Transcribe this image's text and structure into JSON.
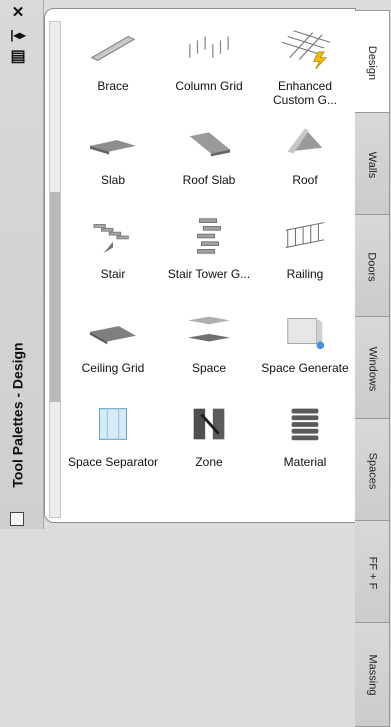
{
  "sidebar": {
    "title": "Tool Palettes - Design",
    "close_glyph": "✕",
    "autohide_glyph": "|◂▸",
    "properties_glyph": "▤",
    "bottom_icon": "palette-menu"
  },
  "tools": [
    {
      "label": "Brace",
      "icon": "brace"
    },
    {
      "label": "Column Grid",
      "icon": "column-grid"
    },
    {
      "label": "Enhanced Custom G...",
      "icon": "enhanced-grid"
    },
    {
      "label": "Slab",
      "icon": "slab"
    },
    {
      "label": "Roof Slab",
      "icon": "roof-slab"
    },
    {
      "label": "Roof",
      "icon": "roof"
    },
    {
      "label": "Stair",
      "icon": "stair"
    },
    {
      "label": "Stair Tower G...",
      "icon": "stair-tower"
    },
    {
      "label": "Railing",
      "icon": "railing"
    },
    {
      "label": "Ceiling Grid",
      "icon": "ceiling-grid"
    },
    {
      "label": "Space",
      "icon": "space"
    },
    {
      "label": "Space Generate",
      "icon": "space-generate"
    },
    {
      "label": "Space Separator",
      "icon": "space-separator"
    },
    {
      "label": "Zone",
      "icon": "zone"
    },
    {
      "label": "Material",
      "icon": "material"
    }
  ],
  "tabs": [
    "Design",
    "Walls",
    "Doors",
    "Windows",
    "Spaces",
    "FF + F",
    "Massing"
  ],
  "colors": {
    "active_tab": "#ffffff",
    "lightning": "#f5b900",
    "space_blue": "#4f8ed8"
  }
}
